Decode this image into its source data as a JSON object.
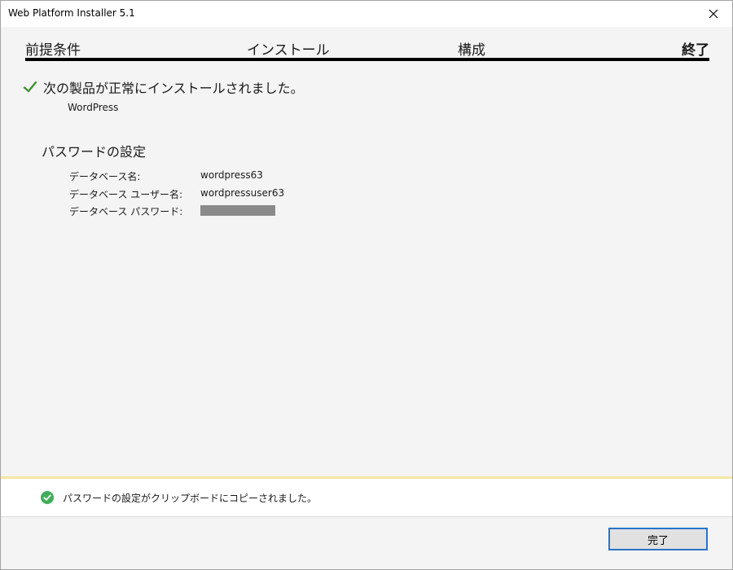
{
  "window": {
    "title": "Web Platform Installer 5.1"
  },
  "steps": [
    {
      "label": "前提条件",
      "active": false
    },
    {
      "label": "インストール",
      "active": false
    },
    {
      "label": "構成",
      "active": false
    },
    {
      "label": "終了",
      "active": true
    }
  ],
  "result": {
    "message": "次の製品が正常にインストールされました。",
    "product": "WordPress"
  },
  "password_settings": {
    "title": "パスワードの設定",
    "fields": [
      {
        "label": "データベース名:",
        "value": "wordpress63"
      },
      {
        "label": "データベース ユーザー名:",
        "value": "wordpressuser63"
      },
      {
        "label": "データベース パスワード:",
        "value": ""
      }
    ]
  },
  "notification": {
    "text": "パスワードの設定がクリップボードにコピーされました。",
    "icon": "success-check-icon"
  },
  "buttons": {
    "finish": "完了"
  },
  "colors": {
    "accent": "#2b74c7",
    "success_green": "#3fae5a",
    "check_green": "#3b8f2b",
    "notify_border": "#f5e7a3",
    "masked": "#8a8a8a"
  }
}
